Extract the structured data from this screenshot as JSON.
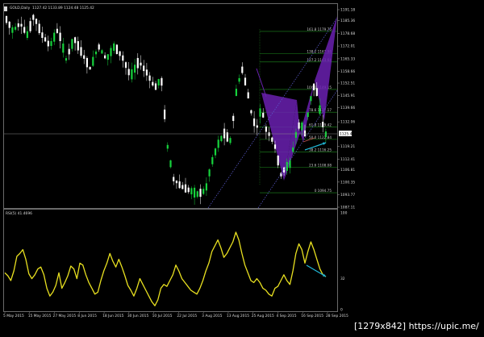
{
  "chart": {
    "symbol": "GOLD,Daily",
    "ohlc": "1127.42 1133.89 1124.48 1125.42",
    "last_price_label": "1125.42"
  },
  "price_axis": [
    {
      "v": 1191.18,
      "label": "1191.18"
    },
    {
      "v": 1185.36,
      "label": "1185.36"
    },
    {
      "v": 1178.68,
      "label": "1178.68"
    },
    {
      "v": 1172.01,
      "label": "1172.01"
    },
    {
      "v": 1165.33,
      "label": "1165.33"
    },
    {
      "v": 1158.66,
      "label": "1158.66"
    },
    {
      "v": 1152.51,
      "label": "1152.51"
    },
    {
      "v": 1145.91,
      "label": "1145.91"
    },
    {
      "v": 1139.66,
      "label": "1139.66"
    },
    {
      "v": 1132.06,
      "label": "1132.06"
    },
    {
      "v": 1119.21,
      "label": "1119.21"
    },
    {
      "v": 1112.41,
      "label": "1112.41"
    },
    {
      "v": 1106.81,
      "label": "1106.81"
    },
    {
      "v": 1100.35,
      "label": "1100.35"
    },
    {
      "v": 1093.77,
      "label": "1093.77"
    },
    {
      "v": 1087.11,
      "label": "1087.11"
    }
  ],
  "fib_levels": [
    {
      "v": 1179.75,
      "label": "161.8 1179.75"
    },
    {
      "v": 1167.98,
      "label": "138.2 1167.98"
    },
    {
      "v": 1163.64,
      "label": "127.2 1163.64"
    },
    {
      "v": 1149.15,
      "label": "100.0 1149.15"
    },
    {
      "v": 1137.17,
      "label": "78.6 1137.17"
    },
    {
      "v": 1129.42,
      "label": "61.8 1129.42"
    },
    {
      "v": 1122.84,
      "label": "50.0 1122.84"
    },
    {
      "v": 1116.25,
      "label": "38.2 1116.25"
    },
    {
      "v": 1108.08,
      "label": "23.6 1108.08"
    },
    {
      "v": 1094.75,
      "label": "0 1094.75"
    }
  ],
  "rsi": {
    "label": "RSI(5) 41.4696",
    "axis": [
      {
        "v": 100,
        "label": "100"
      },
      {
        "v": 32,
        "label": "32"
      },
      {
        "v": 0,
        "label": "0"
      }
    ],
    "values": [
      38,
      35,
      30,
      40,
      55,
      58,
      62,
      52,
      37,
      32,
      36,
      42,
      44,
      36,
      22,
      14,
      18,
      25,
      38,
      22,
      28,
      35,
      45,
      42,
      32,
      48,
      46,
      36,
      28,
      22,
      16,
      18,
      30,
      40,
      48,
      58,
      50,
      44,
      52,
      44,
      35,
      25,
      20,
      14,
      22,
      32,
      26,
      20,
      14,
      8,
      4,
      10,
      22,
      26,
      24,
      30,
      36,
      46,
      40,
      32,
      28,
      24,
      20,
      18,
      16,
      22,
      30,
      40,
      48,
      60,
      66,
      72,
      64,
      54,
      58,
      64,
      70,
      80,
      72,
      58,
      46,
      38,
      30,
      28,
      32,
      28,
      22,
      20,
      16,
      14,
      22,
      24,
      30,
      36,
      30,
      26,
      40,
      58,
      68,
      62,
      48,
      60,
      70,
      62,
      52,
      42,
      36,
      34
    ]
  },
  "dates": [
    "5 May 2015",
    "15 May 2015",
    "27 May 2015",
    "8 Jun 2015",
    "18 Jun 2015",
    "30 Jun 2015",
    "10 Jul 2015",
    "22 Jul 2015",
    "3 Aug 2015",
    "13 Aug 2015",
    "25 Aug 2015",
    "4 Sep 2015",
    "16 Sep 2015",
    "28 Sep 2015"
  ],
  "watermark": "[1279x842] https://upic.me/",
  "colors": {
    "bull": "#16d23c",
    "bear": "#ffffff",
    "pattern": "#6a20b0",
    "rsi_line": "#e8e020",
    "arrow": "#20b8d8",
    "grid": "#444444"
  }
}
